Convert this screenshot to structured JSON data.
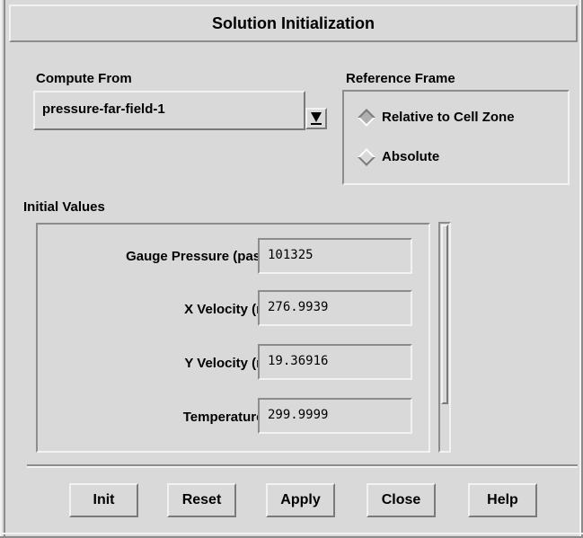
{
  "window": {
    "title": "Solution Initialization"
  },
  "compute_from": {
    "label": "Compute From",
    "selected": "pressure-far-field-1",
    "icon": "dropdown-arrow-icon"
  },
  "reference_frame": {
    "label": "Reference Frame",
    "options": [
      {
        "label": "Relative to Cell Zone",
        "selected": true
      },
      {
        "label": "Absolute",
        "selected": false
      }
    ]
  },
  "initial_values": {
    "label": "Initial Values",
    "fields": [
      {
        "label": "Gauge Pressure (pascal)",
        "value": "101325"
      },
      {
        "label": "X Velocity (m/s)",
        "value": "276.9939"
      },
      {
        "label": "Y Velocity (m/s)",
        "value": "19.36916"
      },
      {
        "label": "Temperature (k)",
        "value": "299.9999"
      }
    ]
  },
  "buttons": {
    "init": "Init",
    "reset": "Reset",
    "apply": "Apply",
    "close": "Close",
    "help": "Help"
  }
}
